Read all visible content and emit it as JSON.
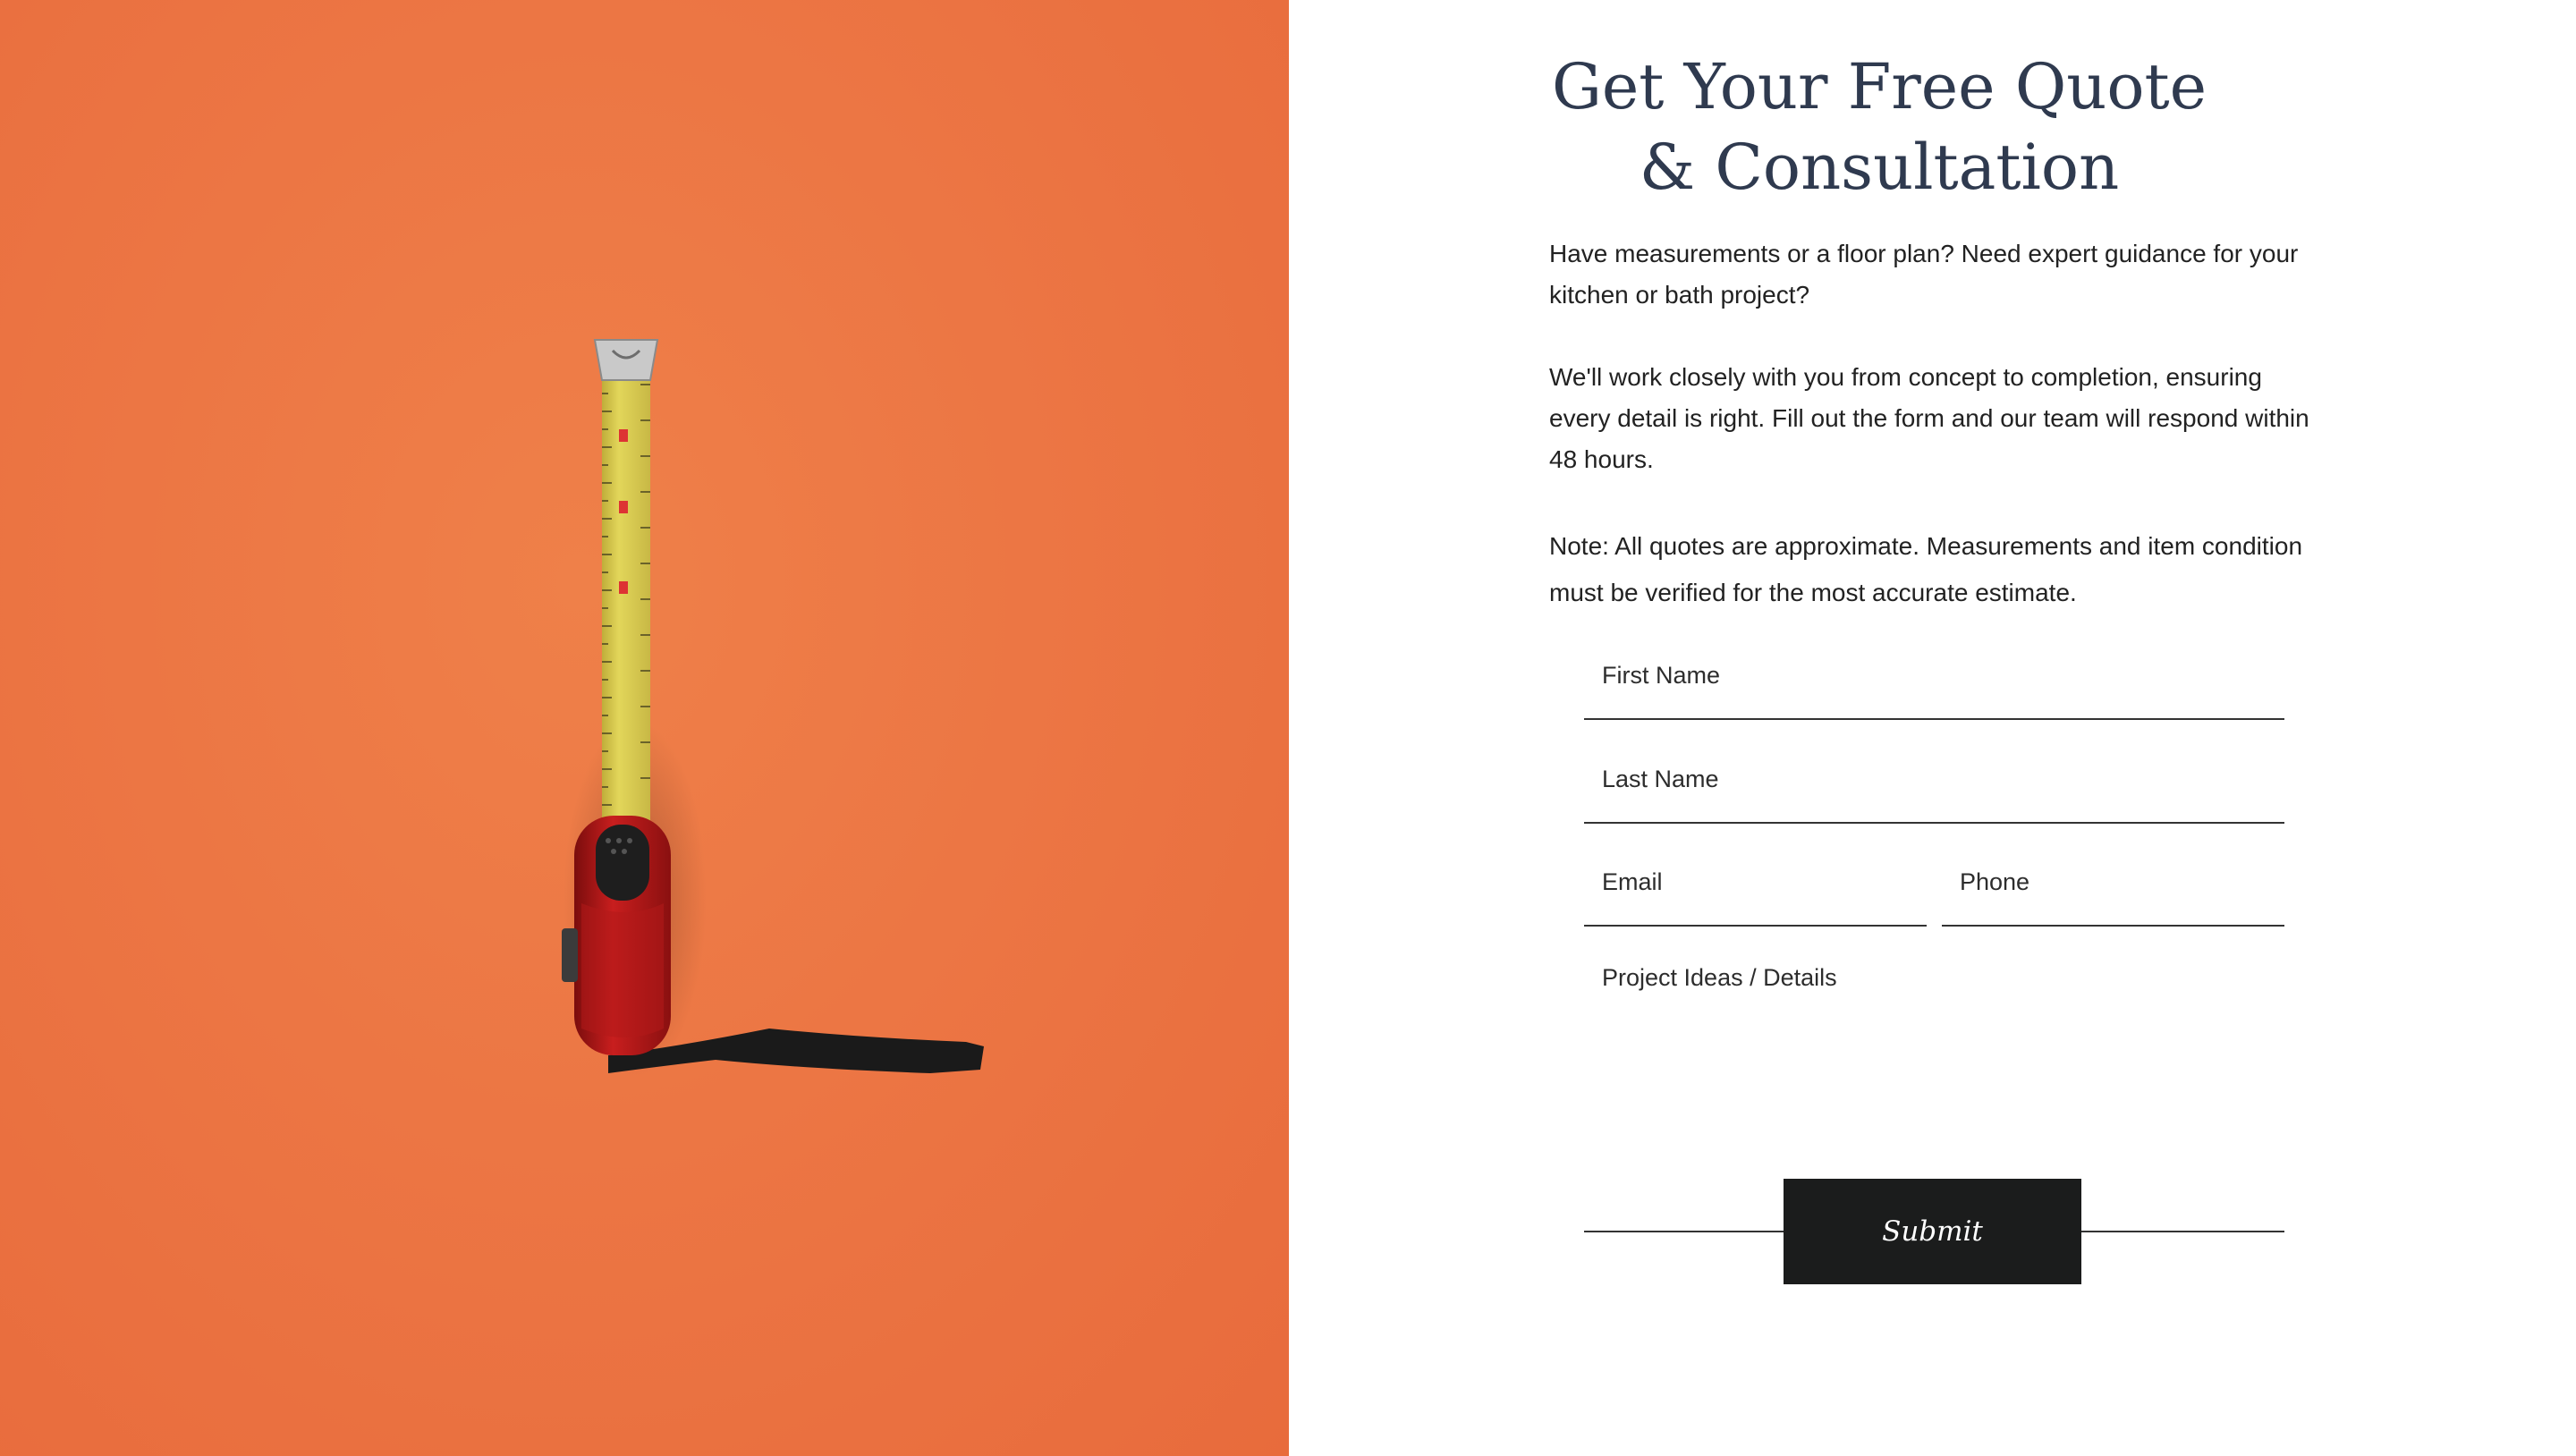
{
  "hero": {
    "image_subject": "tape-measure",
    "background_color": "#ec7644"
  },
  "form_section": {
    "title": "Get Your Free Quote & Consultation",
    "intro": "Have measurements or a floor plan? Need expert guidance for your kitchen or bath project?",
    "description": "We'll work closely with you from concept to completion, ensuring every detail is right. Fill out the form and our team will respond within 48 hours.",
    "note": "Note: All quotes are approximate. Measurements and item condition must be verified for the most accurate estimate.",
    "fields": {
      "first_name": "First Name",
      "last_name": "Last Name",
      "email": "Email",
      "phone": "Phone",
      "details": "Project Ideas / Details"
    },
    "submit_label": "Submit"
  },
  "colors": {
    "title": "#2f3a4f",
    "button": "#1b1c1c",
    "accent": "#ec7644"
  }
}
